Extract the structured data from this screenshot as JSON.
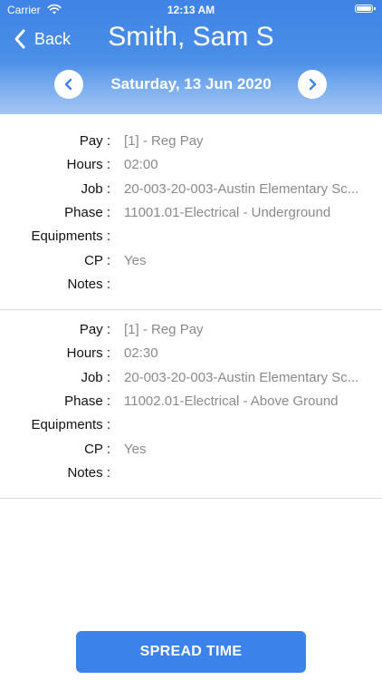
{
  "status_bar": {
    "carrier": "Carrier",
    "time": "12:13 AM"
  },
  "header": {
    "back_label": "Back",
    "employee_name": "Smith, Sam S",
    "date": "Saturday, 13 Jun 2020"
  },
  "icons": {
    "back": "chevron-left-icon",
    "prev": "chevron-left-icon",
    "next": "chevron-right-icon",
    "wifi": "wifi-icon",
    "battery": "battery-icon"
  },
  "colors": {
    "accent": "#3b82ea",
    "label": "#111111",
    "value": "#8a8a8a"
  },
  "labels": {
    "pay": "Pay :",
    "hours": "Hours :",
    "job": "Job :",
    "phase": "Phase :",
    "equipments": "Equipments :",
    "cp": "CP :",
    "notes": "Notes :"
  },
  "entries": [
    {
      "pay": "[1] - Reg Pay",
      "hours": "02:00",
      "job": "20-003-20-003-Austin Elementary Sc...",
      "phase": "11001.01-Electrical - Underground",
      "equipments": "",
      "cp": "Yes",
      "notes": ""
    },
    {
      "pay": "[1] - Reg Pay",
      "hours": "02:30",
      "job": "20-003-20-003-Austin Elementary Sc...",
      "phase": "11002.01-Electrical - Above Ground",
      "equipments": "",
      "cp": "Yes",
      "notes": ""
    }
  ],
  "footer": {
    "spread_time_label": "SPREAD TIME"
  }
}
